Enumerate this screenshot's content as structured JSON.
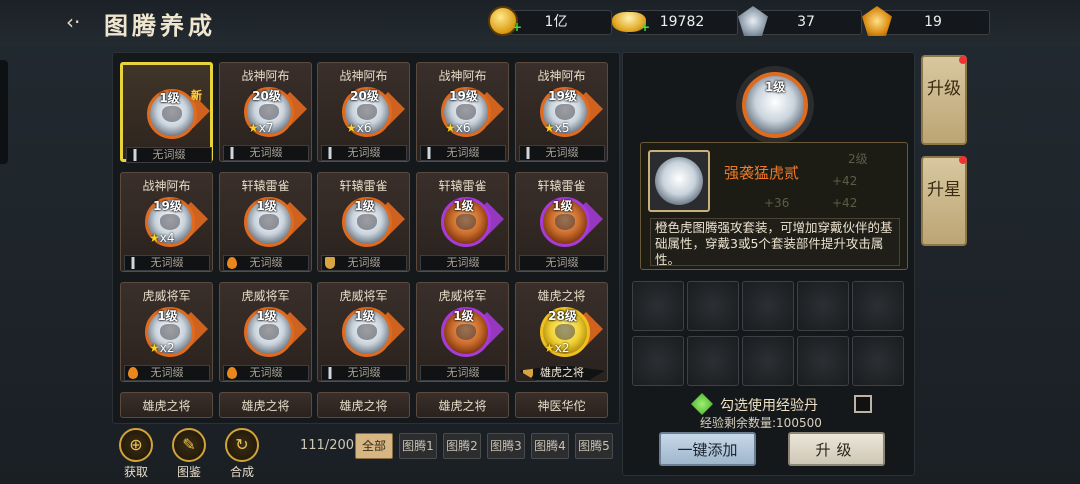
{
  "header": {
    "title": "图腾养成",
    "back_icon": "back-arrow-icon"
  },
  "resources": [
    {
      "name": "copper-coin",
      "value": "1亿"
    },
    {
      "name": "gold-ingot",
      "value": "19782"
    },
    {
      "name": "silver-crystal",
      "value": "37"
    },
    {
      "name": "gold-crystal",
      "value": "19"
    }
  ],
  "cards": [
    {
      "name": "",
      "level": "1级",
      "stars": "",
      "tag": "新",
      "bar": "无词缀",
      "bar_icon": "sword",
      "color": "white",
      "selected": true
    },
    {
      "name": "战神阿布",
      "level": "20级",
      "stars": "x7",
      "tag": "",
      "bar": "无词缀",
      "bar_icon": "sword",
      "color": "white"
    },
    {
      "name": "战神阿布",
      "level": "20级",
      "stars": "x6",
      "tag": "",
      "bar": "无词缀",
      "bar_icon": "sword",
      "color": "white"
    },
    {
      "name": "战神阿布",
      "level": "19级",
      "stars": "x6",
      "tag": "",
      "bar": "无词缀",
      "bar_icon": "sword",
      "color": "white"
    },
    {
      "name": "战神阿布",
      "level": "19级",
      "stars": "x5",
      "tag": "",
      "bar": "无词缀",
      "bar_icon": "sword",
      "color": "white"
    },
    {
      "name": "战神阿布",
      "level": "19级",
      "stars": "x4",
      "tag": "",
      "bar": "无词缀",
      "bar_icon": "sword",
      "color": "white"
    },
    {
      "name": "轩辕雷雀",
      "level": "1级",
      "stars": "",
      "tag": "",
      "bar": "无词缀",
      "bar_icon": "drop",
      "color": "white"
    },
    {
      "name": "轩辕雷雀",
      "level": "1级",
      "stars": "",
      "tag": "",
      "bar": "无词缀",
      "bar_icon": "shield",
      "color": "white"
    },
    {
      "name": "轩辕雷雀",
      "level": "1级",
      "stars": "",
      "tag": "",
      "bar": "无词缀",
      "bar_icon": "",
      "color": "purple"
    },
    {
      "name": "轩辕雷雀",
      "level": "1级",
      "stars": "",
      "tag": "",
      "bar": "无词缀",
      "bar_icon": "",
      "color": "purple"
    },
    {
      "name": "虎威将军",
      "level": "1级",
      "stars": "x2",
      "tag": "",
      "bar": "无词缀",
      "bar_icon": "drop",
      "color": "white"
    },
    {
      "name": "虎威将军",
      "level": "1级",
      "stars": "",
      "tag": "",
      "bar": "无词缀",
      "bar_icon": "drop",
      "color": "white"
    },
    {
      "name": "虎威将军",
      "level": "1级",
      "stars": "",
      "tag": "",
      "bar": "无词缀",
      "bar_icon": "sword",
      "color": "white"
    },
    {
      "name": "虎威将军",
      "level": "1级",
      "stars": "",
      "tag": "",
      "bar": "无词缀",
      "bar_icon": "",
      "color": "purple"
    },
    {
      "name": "雄虎之将",
      "level": "28级",
      "stars": "x2",
      "tag": "",
      "bar": "雄虎之将",
      "bar_icon": "shield",
      "color": "yellow"
    },
    {
      "name": "雄虎之将",
      "level": "",
      "stars": "",
      "tag": "",
      "bar": "",
      "bar_icon": "",
      "color": "none"
    },
    {
      "name": "雄虎之将",
      "level": "",
      "stars": "",
      "tag": "",
      "bar": "",
      "bar_icon": "",
      "color": "none"
    },
    {
      "name": "雄虎之将",
      "level": "",
      "stars": "",
      "tag": "",
      "bar": "",
      "bar_icon": "",
      "color": "none"
    },
    {
      "name": "雄虎之将",
      "level": "",
      "stars": "",
      "tag": "",
      "bar": "",
      "bar_icon": "",
      "color": "none"
    },
    {
      "name": "神医华佗",
      "level": "",
      "stars": "",
      "tag": "",
      "bar": "",
      "bar_icon": "",
      "color": "none"
    }
  ],
  "bottom_actions": [
    {
      "label": "获取",
      "icon": "obtain-icon"
    },
    {
      "label": "图鉴",
      "icon": "codex-icon"
    },
    {
      "label": "合成",
      "icon": "compose-icon"
    }
  ],
  "inventory": {
    "count": "111/200"
  },
  "filter_tabs": [
    "全部",
    "图腾1",
    "图腾2",
    "图腾3",
    "图腾4",
    "图腾5"
  ],
  "selected": {
    "level": "1级",
    "name": "强袭猛虎贰",
    "desc": "橙色虎图腾强攻套装，可增加穿戴伙伴的基础属性，穿戴3或5个套装部件提升攻击属性。",
    "ghost": [
      "2级",
      "+42",
      "+36",
      "+42"
    ]
  },
  "exp": {
    "checkbox_label": "勾选使用经验丹",
    "remaining": "经验剩余数量:100500"
  },
  "buttons": {
    "add": "一键添加",
    "upgrade": "升级"
  },
  "side_tabs": {
    "upgrade": "升级",
    "star": "升星"
  }
}
